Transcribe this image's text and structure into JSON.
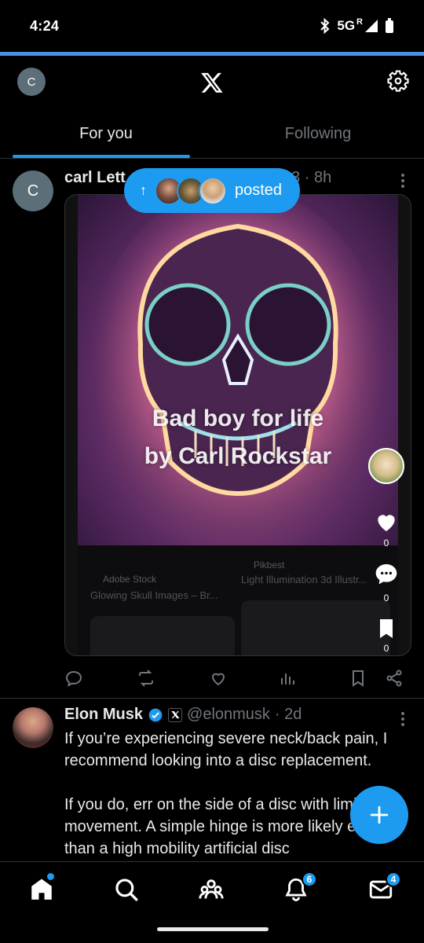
{
  "status_bar": {
    "time": "4:24",
    "network": "5G",
    "roaming": "R"
  },
  "header": {
    "account_initial": "C",
    "logo": "x-logo-icon",
    "settings": "gear-icon"
  },
  "tabs": [
    {
      "label": "For you",
      "active": true
    },
    {
      "label": "Following",
      "active": false
    }
  ],
  "posted_pill": {
    "text": "posted",
    "arrow": "↑"
  },
  "post1": {
    "avatar_initial": "C",
    "author": "carl Lett",
    "meta": "33 · 8h",
    "media": {
      "overlay_line1": "Bad boy for life",
      "overlay_line2": "by Carl Rockstar",
      "thumb1_source": "Adobe Stock",
      "thumb1_title": "Glowing Skull Images – Br...",
      "thumb2_source": "Pikbest",
      "thumb2_title": "Light Illumination 3d Illustr..."
    },
    "side_counts": {
      "likes": "0",
      "comments": "0",
      "bookmarks": "0"
    }
  },
  "post2": {
    "author": "Elon Musk",
    "handle": "@elonmusk",
    "time": "· 2d",
    "paragraph1": "If you’re experiencing severe neck/back pain, I recommend looking into a disc replacement.",
    "paragraph2": "If you do, err on the side of a disc with limited movement. A simple hinge is more likely effective than a high mobility artificial disc"
  },
  "bottom_nav": {
    "notifications_badge": "6",
    "messages_badge": "4"
  },
  "colors": {
    "accent": "#1d9bf0",
    "background": "#000000",
    "muted": "#71767b"
  }
}
